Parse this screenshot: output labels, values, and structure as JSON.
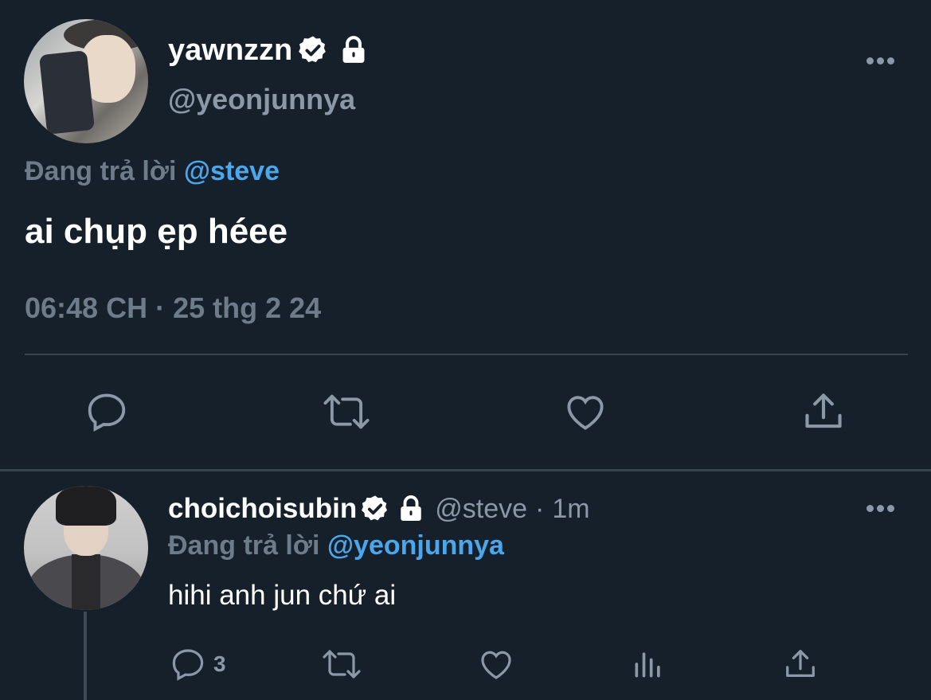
{
  "main_tweet": {
    "display_name": "yawnzzn",
    "handle": "@yeonjunnya",
    "replying_label": "Đang trả lời",
    "replying_to": "@steve",
    "text": "ai chụp ẹp héee",
    "timestamp": "06:48 CH · 25 thg 2 24",
    "icons": [
      "reply-icon",
      "retweet-icon",
      "like-icon",
      "share-icon"
    ]
  },
  "reply_tweet": {
    "display_name": "choichoisubin",
    "handle": "@steve",
    "separator": "·",
    "time": "1m",
    "replying_label": "Đang trả lời",
    "replying_to": "@yeonjunnya",
    "text": "hihi anh jun chứ ai",
    "reply_count": "3",
    "icons": [
      "reply-icon",
      "retweet-icon",
      "like-icon",
      "stats-icon",
      "share-icon"
    ]
  },
  "colors": {
    "background": "#15202b",
    "mention": "#4ba6ec",
    "muted": "#8b98a5",
    "divider": "#38444d"
  }
}
